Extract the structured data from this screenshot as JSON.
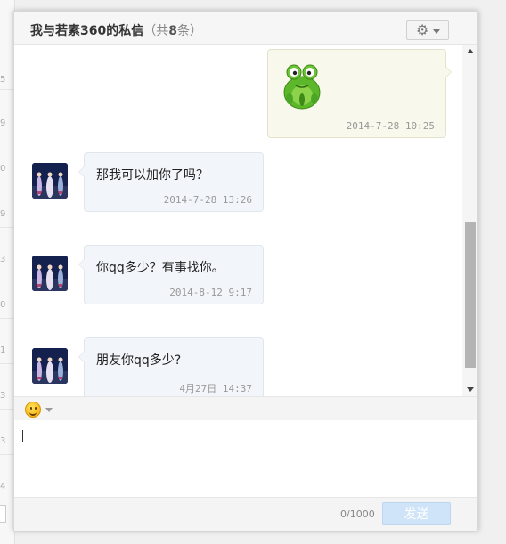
{
  "dialog": {
    "title_main": "我与若素360的私信",
    "title_count_prefix": "（共",
    "title_count_number": "8",
    "title_count_suffix": "条）",
    "settings_icon": "gear-icon"
  },
  "messages": [
    {
      "sender": "me",
      "content_type": "sticker",
      "sticker": "green-frog-sticker",
      "time": "2014-7-28 10:25"
    },
    {
      "sender": "other",
      "text": "那我可以加你了吗？",
      "time": "2014-7-28 13:26"
    },
    {
      "sender": "other",
      "text": "你qq多少？有事找你。",
      "time": "2014-8-12 9:17"
    },
    {
      "sender": "other",
      "text": "朋友你qq多少?",
      "time": "4月27日 14:37"
    }
  ],
  "composer": {
    "emoji_icon": "smiley-icon",
    "value": "",
    "char_count": "0/1000",
    "send_label": "发送"
  },
  "background": {
    "edge_digits": [
      "5",
      "9",
      "0",
      "9",
      "3",
      "0",
      "1",
      "3",
      "3",
      "4"
    ]
  },
  "colors": {
    "send_button": "#cfe4f8",
    "my_bubble": "#f8f8ec",
    "their_bubble": "#f2f6fa"
  }
}
